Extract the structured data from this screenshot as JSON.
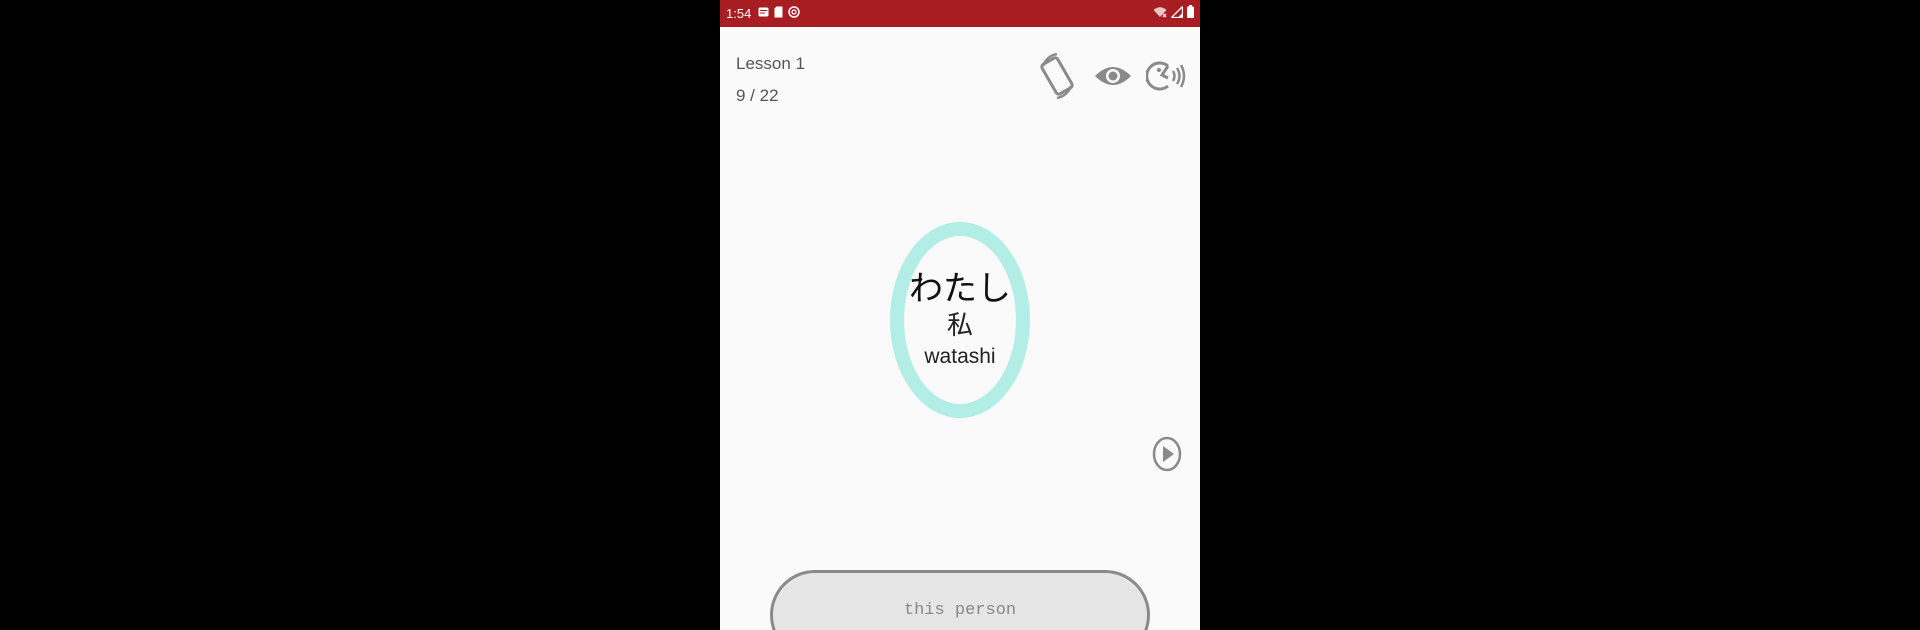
{
  "status_bar": {
    "time": "1:54",
    "background": "#a71d22"
  },
  "lesson": {
    "title": "Lesson 1",
    "progress": "9 / 22"
  },
  "toolbar": {
    "icons": [
      "rotate-screen-icon",
      "eye-icon",
      "speaker-voice-icon"
    ]
  },
  "word": {
    "kana": "わたし",
    "kanji": "私",
    "romaji": "watashi",
    "ring_color": "#b2eee5"
  },
  "meaning": {
    "text": "this person"
  }
}
